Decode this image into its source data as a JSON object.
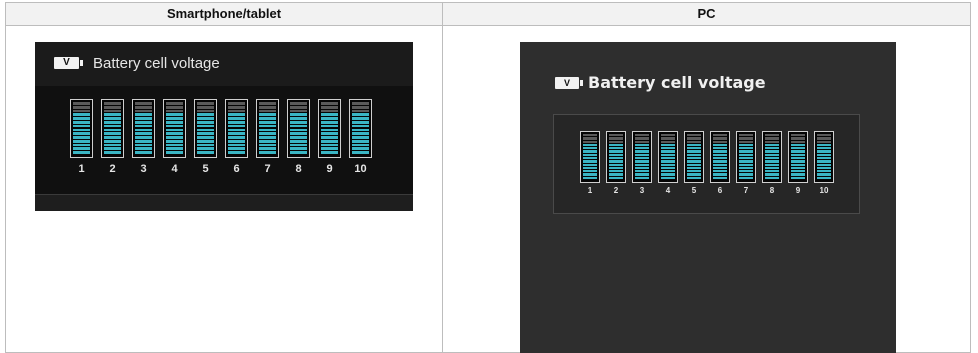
{
  "table": {
    "headers": [
      "Smartphone/tablet",
      "PC"
    ]
  },
  "smartphone": {
    "badge": "V",
    "title": "Battery cell voltage",
    "cells": [
      {
        "label": "1",
        "level": 0.8
      },
      {
        "label": "2",
        "level": 0.8
      },
      {
        "label": "3",
        "level": 0.8
      },
      {
        "label": "4",
        "level": 0.8
      },
      {
        "label": "5",
        "level": 0.8
      },
      {
        "label": "6",
        "level": 0.8
      },
      {
        "label": "7",
        "level": 0.8
      },
      {
        "label": "8",
        "level": 0.8
      },
      {
        "label": "9",
        "level": 0.8
      },
      {
        "label": "10",
        "level": 0.8
      }
    ]
  },
  "pc": {
    "badge": "V",
    "title": "Battery cell voltage",
    "cells": [
      {
        "label": "1",
        "level": 0.8
      },
      {
        "label": "2",
        "level": 0.8
      },
      {
        "label": "3",
        "level": 0.8
      },
      {
        "label": "4",
        "level": 0.8
      },
      {
        "label": "5",
        "level": 0.8
      },
      {
        "label": "6",
        "level": 0.8
      },
      {
        "label": "7",
        "level": 0.8
      },
      {
        "label": "8",
        "level": 0.8
      },
      {
        "label": "9",
        "level": 0.8
      },
      {
        "label": "10",
        "level": 0.8
      }
    ]
  },
  "colors": {
    "segment_filled": "#3ab5c4",
    "segment_empty": "#5a5a5a",
    "cell_border": "#cfcfcf"
  }
}
